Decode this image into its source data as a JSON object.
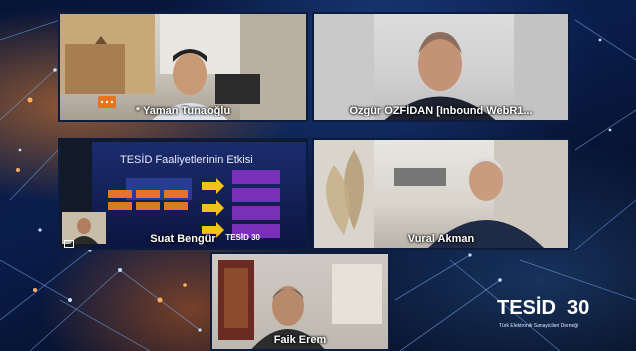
{
  "participants": [
    {
      "name": "* Yaman Tunaoğlu"
    },
    {
      "name": "Özgür ÖZFİDAN [Inbound WebR1..."
    },
    {
      "name": "Suat Bengür"
    },
    {
      "name": "Vural Akman"
    },
    {
      "name": "Faik Erem"
    }
  ],
  "slide": {
    "title": "TESİD Faaliyetlerinin Etkisi",
    "badge": "TESİD 30"
  },
  "logo": {
    "brand": "TESİD",
    "number": "30",
    "subtitle": "Türk Elektronik Sanayicileri Derneği"
  },
  "colors": {
    "tile_border": "#0c1c3c",
    "slide_purple": "#7a2fb8",
    "slide_orange": "#e0762a",
    "arrow_yellow": "#f2c21b"
  }
}
